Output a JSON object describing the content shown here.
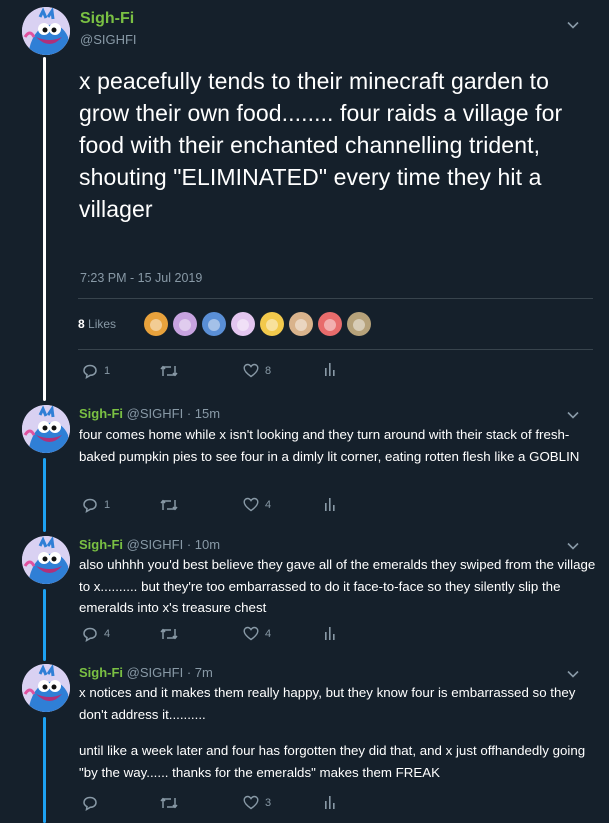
{
  "main": {
    "name": "Sigh-Fi",
    "handle": "@SIGHFI",
    "text": "x peacefully tends to their minecraft garden to grow their own food........ four raids a village for food with their enchanted channelling trident, shouting \"ELIMINATED\" every time they hit a villager",
    "timestamp": "7:23 PM - 15 Jul 2019",
    "likes_count": "8",
    "likes_label": "Likes",
    "likers": [
      "#e8a23c",
      "#c7a3e0",
      "#5a8fd6",
      "#e3c6f0",
      "#f2c94c",
      "#d9b38c",
      "#e86c6c",
      "#b6a27a"
    ],
    "reply_count": "1",
    "retweet_count": "",
    "like_count": "8"
  },
  "replies": [
    {
      "name": "Sigh-Fi",
      "handle": "@SIGHFI",
      "age": "· 15m",
      "text": "four comes home while x isn't looking and they turn around with their stack of fresh-baked pumpkin pies to see four in a dimly lit corner, eating rotten flesh like a GOBLIN",
      "reply_count": "1",
      "like_count": "4"
    },
    {
      "name": "Sigh-Fi",
      "handle": "@SIGHFI",
      "age": "· 10m",
      "text": "also uhhhh you'd best believe they gave all of the emeralds they swiped from the village to x.......... but they're too embarrassed to do it face-to-face so they silently slip the emeralds into x's treasure chest",
      "reply_count": "4",
      "like_count": "4"
    },
    {
      "name": "Sigh-Fi",
      "handle": "@SIGHFI",
      "age": "· 7m",
      "text_p1": "x notices and it makes them really happy, but they know four is embarrassed so they don't address it..........",
      "text_p2": "until like a week later and four has forgotten they did that, and x just offhandedly going \"by the way...... thanks for the emeralds\" makes them FREAK",
      "reply_count": "",
      "like_count": "3"
    }
  ],
  "colors": {
    "background": "#15202b",
    "name_green": "#7ac043",
    "muted": "#8899a6",
    "thread_white": "#ffffff",
    "thread_blue": "#1da1f2"
  }
}
